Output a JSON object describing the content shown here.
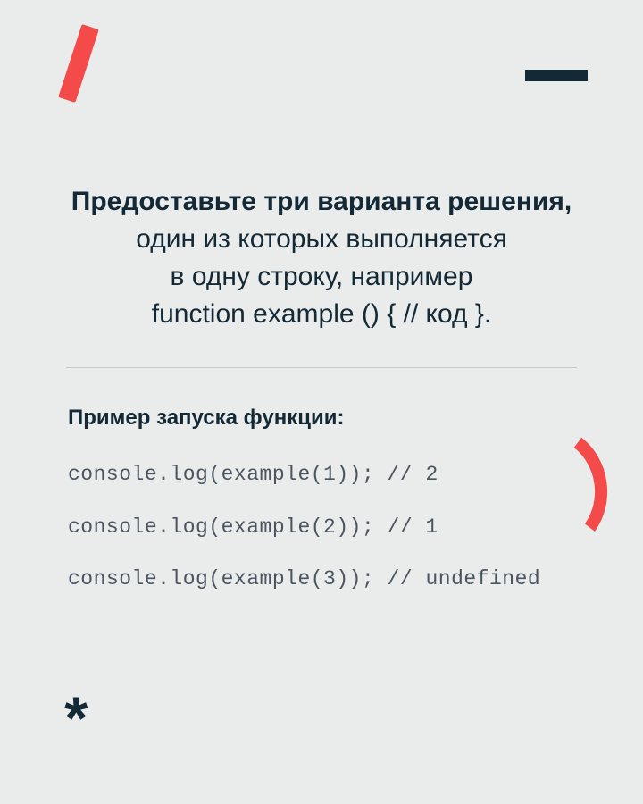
{
  "heading": {
    "bold": "Предоставьте три варианта решения,",
    "line2": "один из которых выполняется",
    "line3": "в одну строку, например",
    "line4": "function example () {  // код }."
  },
  "example": {
    "title": "Пример запуска функции:",
    "lines": [
      "console.log(example(1)); // 2",
      "console.log(example(2)); // 1",
      "console.log(example(3)); // undefined"
    ]
  },
  "decorations": {
    "asterisk": "*"
  }
}
